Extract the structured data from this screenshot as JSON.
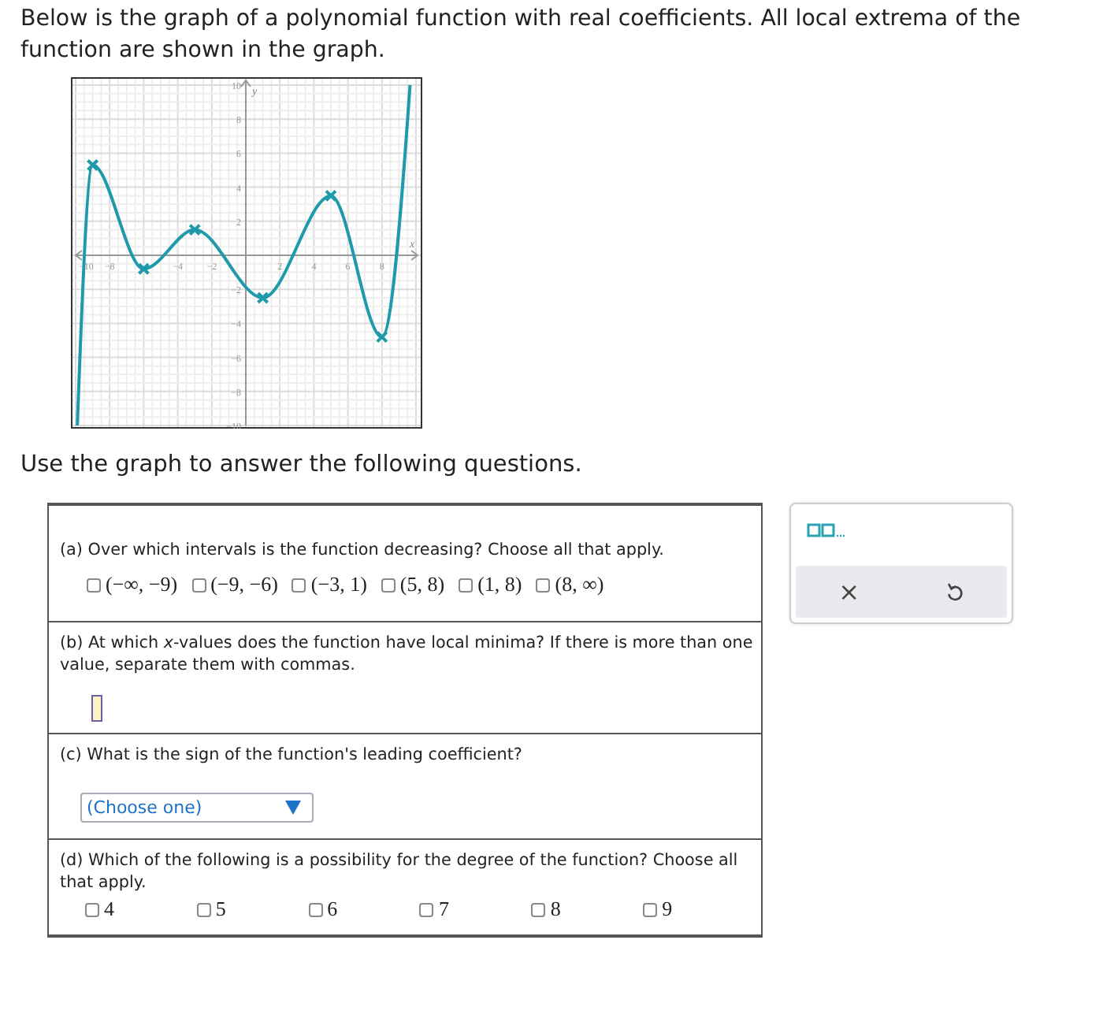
{
  "intro": "Below is the graph of a polynomial function with real coefficients. All local extrema of the function are shown in the graph.",
  "graph": {
    "chart_data": {
      "type": "line",
      "grid": true,
      "xlabel": "x",
      "ylabel": "y",
      "xlim": [
        -10,
        10
      ],
      "ylim": [
        -10,
        10
      ],
      "xticks": [
        -10,
        -8,
        -4,
        -2,
        2,
        4,
        6,
        8
      ],
      "yticks": [
        -10,
        -8,
        -6,
        -4,
        -2,
        2,
        4,
        6,
        8,
        10
      ],
      "x": [
        -9.9,
        -9,
        -6,
        -3,
        1,
        5,
        8,
        9.65
      ],
      "series": [
        {
          "color": "#1f9aaa",
          "values": [
            -10,
            5.3,
            -0.8,
            1.5,
            -2.5,
            3.5,
            -4.8,
            10
          ]
        }
      ]
    }
  },
  "prompt": "Use the graph to answer the following questions.",
  "questions": [
    {
      "kind": "checklist",
      "text": "(a) Over which intervals is the function decreasing? Choose all that apply.",
      "options": [
        {
          "label": "(−∞, −9)",
          "checked": false
        },
        {
          "label": "(−9, −6)",
          "checked": false
        },
        {
          "label": "(−3, 1)",
          "checked": false
        },
        {
          "label": "(5, 8)",
          "checked": false
        },
        {
          "label": "(1, 8)",
          "checked": false
        },
        {
          "label": "(8, ∞)",
          "checked": false
        }
      ]
    },
    {
      "kind": "input",
      "text": "(b) At which *x*-values does the function have local minima? If there is more than one value, separate them with commas."
    },
    {
      "kind": "dropdown",
      "text": "(c) What is the sign of the function's leading coefficient?",
      "placeholder": "(Choose one)"
    },
    {
      "kind": "checklist",
      "text": "(d) Which of the following is a possibility for the degree of the function? Choose all that apply.",
      "options": [
        {
          "label": "4",
          "checked": false
        },
        {
          "label": "5",
          "checked": false
        },
        {
          "label": "6",
          "checked": false
        },
        {
          "label": "7",
          "checked": false
        },
        {
          "label": "8",
          "checked": false
        },
        {
          "label": "9",
          "checked": false
        }
      ]
    }
  ],
  "tools": {
    "clear": "×"
  }
}
